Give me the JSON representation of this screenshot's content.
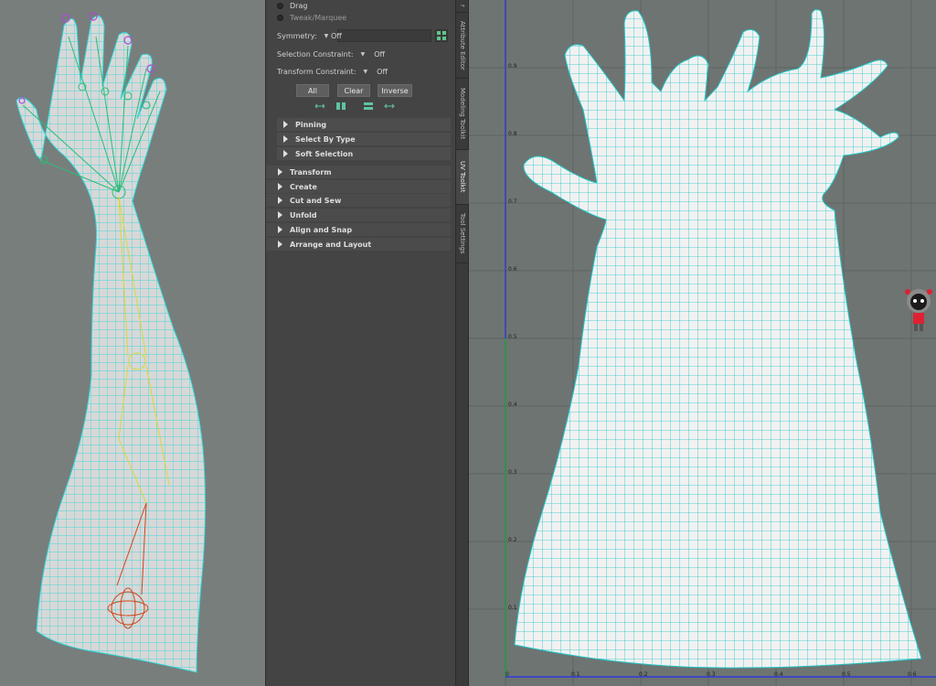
{
  "toolkit": {
    "radio_drag": "Drag",
    "radio_tweak": "Tweak/Marquee",
    "symmetry_label": "Symmetry:",
    "symmetry_value": "Off",
    "selection_constraint_label": "Selection Constraint:",
    "selection_constraint_value": "Off",
    "transform_constraint_label": "Transform Constraint:",
    "transform_constraint_value": "Off",
    "btn_all": "All",
    "btn_clear": "Clear",
    "btn_inverse": "Inverse",
    "sub_sections": [
      "Pinning",
      "Select By Type",
      "Soft Selection"
    ],
    "sections": [
      "Transform",
      "Create",
      "Cut and Sew",
      "Unfold",
      "Align and Snap",
      "Arrange and Layout"
    ]
  },
  "vtabs": {
    "tab_top": "r",
    "attribute_editor": "Attribute Editor",
    "modeling_toolkit": "Modeling Toolkit",
    "uv_toolkit": "UV Toolkit",
    "tool_settings": "Tool Settings"
  },
  "uv_axis": {
    "y_ticks": [
      "0.9",
      "0.8",
      "0.7",
      "0.6",
      "0.5",
      "0.4",
      "0.3",
      "0.2",
      "0.1"
    ],
    "x_ticks": [
      "0",
      "0.1",
      "0.2",
      "0.3",
      "0.4",
      "0.5",
      "0.6"
    ]
  },
  "colors": {
    "wire": "#2fd6d6",
    "mesh_fill": "#f1f1f1",
    "joint_green": "#2dbb7a",
    "joint_yellow": "#d8d838",
    "joint_red": "#d2441a",
    "axis_blue": "#2b3bd6",
    "axis_green": "#2aa33a"
  },
  "icons": [
    "symmetry-grid-icon",
    "uv-tool-icon-1",
    "uv-tool-icon-2",
    "uv-tool-icon-3",
    "uv-tool-icon-4",
    "mascot-icon"
  ]
}
